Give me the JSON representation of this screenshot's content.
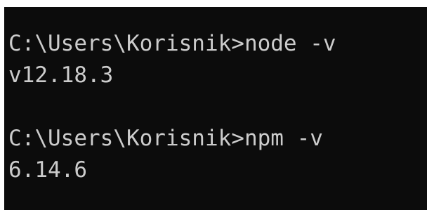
{
  "terminal": {
    "lines": [
      "C:\\Users\\Korisnik>node -v",
      "v12.18.3",
      "",
      "C:\\Users\\Korisnik>npm -v",
      "6.14.6"
    ]
  },
  "colors": {
    "background": "#0c0c0c",
    "text": "#cccccc",
    "page": "#ffffff"
  }
}
